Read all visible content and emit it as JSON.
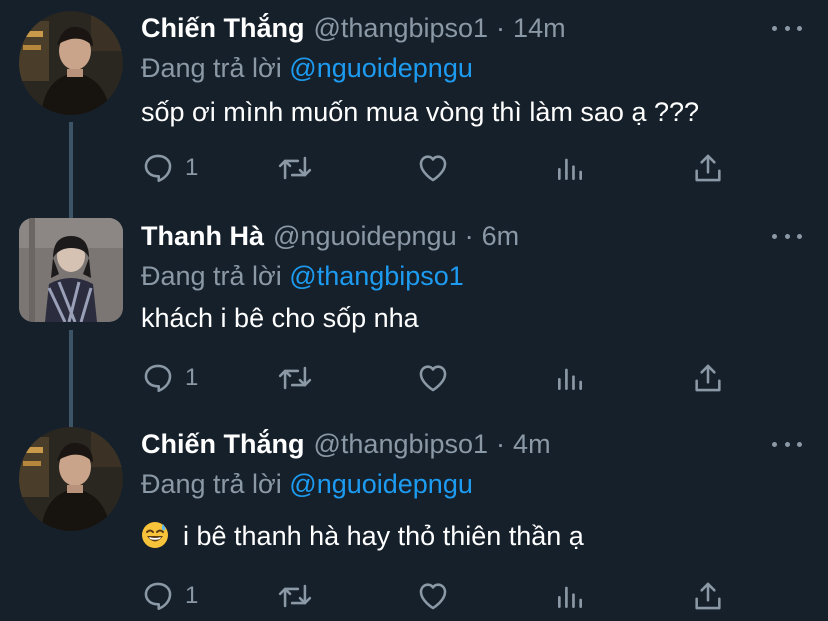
{
  "tweets": [
    {
      "name": "Chiến Thắng",
      "handle": "@thangbipso1",
      "dot": "·",
      "time": "14m",
      "replying_label": "Đang trả lời",
      "replying_to": "@nguoidepngu",
      "text": "sốp ơi mình muốn mua vòng thì làm sao ạ ???",
      "reply_count": "1"
    },
    {
      "name": "Thanh Hà",
      "handle": "@nguoidepngu",
      "dot": "·",
      "time": "6m",
      "replying_label": "Đang trả lời",
      "replying_to": "@thangbipso1",
      "text": "khách i bê cho sốp nha",
      "reply_count": "1"
    },
    {
      "name": "Chiến Thắng",
      "handle": "@thangbipso1",
      "dot": "·",
      "time": "4m",
      "replying_label": "Đang trả lời",
      "replying_to": "@nguoidepngu",
      "text": "i bê thanh hà hay thỏ thiên thần ạ",
      "text_emoji": "grinning-sweat-emoji",
      "reply_count": "1"
    }
  ],
  "icons": {
    "reply": "reply-icon",
    "retweet": "retweet-icon",
    "like": "heart-icon",
    "views": "analytics-icon",
    "share": "share-icon",
    "more": "more-options-icon"
  },
  "colors": {
    "background": "#15202b",
    "primary_text": "#ffffff",
    "secondary_text": "#8b98a5",
    "mention": "#1d9bf0",
    "thread_line": "#3d5466"
  }
}
